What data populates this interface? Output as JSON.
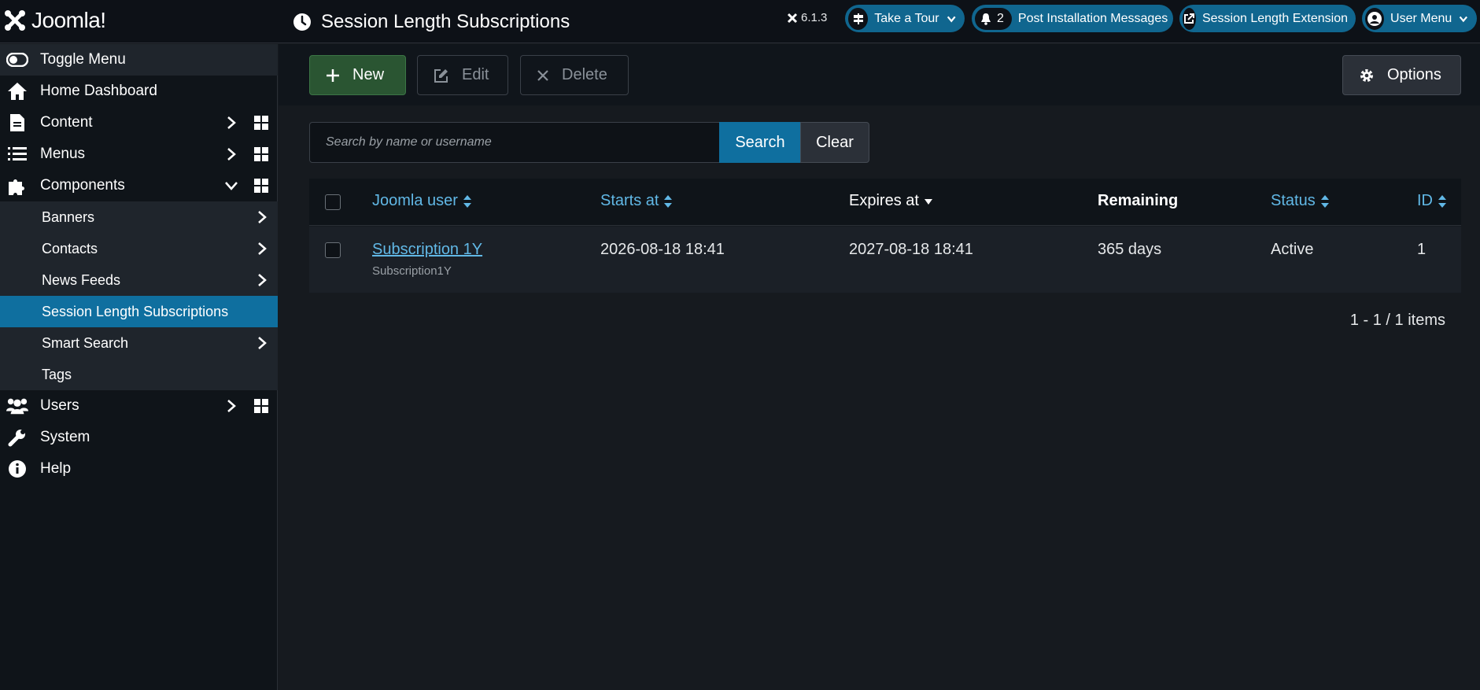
{
  "header": {
    "logo_text": "Joomla!",
    "page_title": "Session Length Subscriptions",
    "version": "6.1.3",
    "take_tour": "Take a Tour",
    "notifications_count": "2",
    "post_install": "Post Installation Messages",
    "extension_link": "Session Length Extension",
    "user_menu": "User Menu"
  },
  "sidebar": {
    "toggle": "Toggle Menu",
    "home": "Home Dashboard",
    "content": "Content",
    "menus": "Menus",
    "components": "Components",
    "sub": [
      "Banners",
      "Contacts",
      "News Feeds",
      "Session Length Subscriptions",
      "Smart Search",
      "Tags"
    ],
    "users": "Users",
    "system": "System",
    "help": "Help"
  },
  "toolbar": {
    "new": "New",
    "edit": "Edit",
    "delete": "Delete",
    "options": "Options"
  },
  "search": {
    "placeholder": "Search by name or username",
    "search_label": "Search",
    "clear_label": "Clear"
  },
  "table": {
    "columns": [
      "Joomla user",
      "Starts at",
      "Expires at",
      "Remaining",
      "Status",
      "ID"
    ],
    "rows": [
      {
        "user": "Subscription 1Y",
        "username": "Subscription1Y",
        "starts": "2026-08-18 18:41",
        "expires": "2027-08-18 18:41",
        "remaining": "365 days",
        "status": "Active",
        "id": "1"
      }
    ]
  },
  "pagination": "1 - 1 / 1 items",
  "colors": {
    "accent": "#0f6f9f",
    "link": "#61b8e6",
    "new_button": "#2a5532"
  }
}
